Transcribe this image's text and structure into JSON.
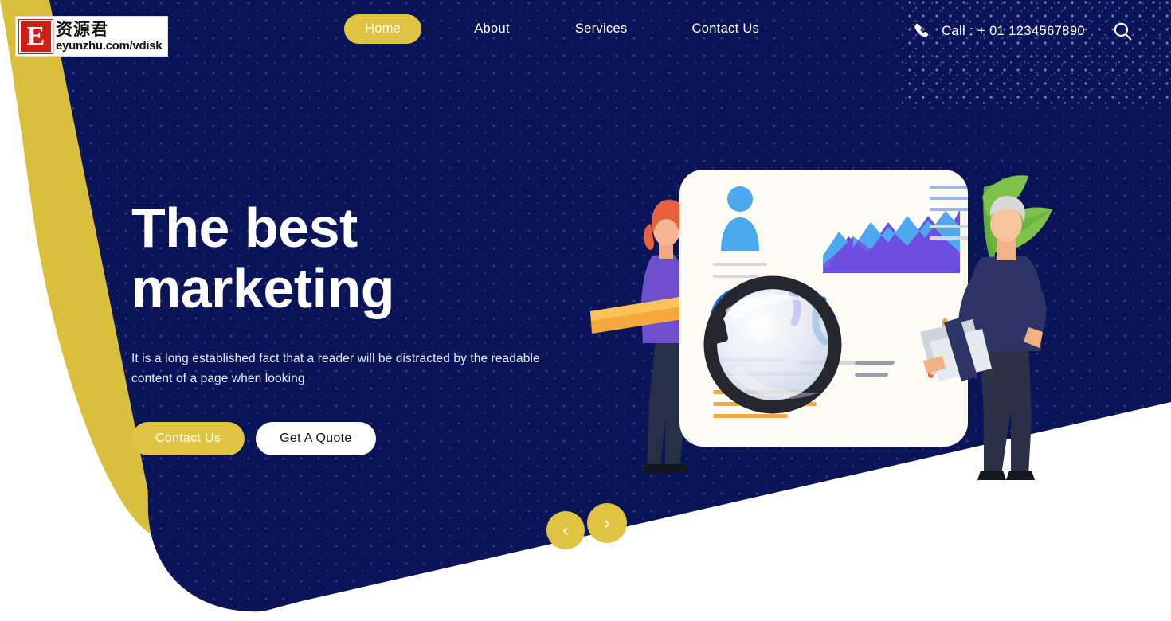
{
  "brand": {
    "logo_letter": "E",
    "logo_cn": "资源君",
    "logo_url": "eyunzhu.com/vdisk"
  },
  "nav": {
    "items": [
      {
        "label": "Home",
        "active": true
      },
      {
        "label": "About",
        "active": false
      },
      {
        "label": "Services",
        "active": false
      },
      {
        "label": "Contact Us",
        "active": false
      }
    ],
    "phone_icon": "phone-icon",
    "call_text": "Call : + 01 1234567890",
    "search_icon": "search-icon"
  },
  "hero": {
    "title_line1": "The best",
    "title_line2": "marketing",
    "paragraph": "It is a long established fact that a reader will be distracted by the readable content of a page when looking",
    "primary_button": "Contact Us",
    "secondary_button": "Get A Quote"
  },
  "carousel": {
    "prev_icon": "‹",
    "next_icon": "›"
  },
  "colors": {
    "navy": "#0a1559",
    "yellow": "#e0c341",
    "cream": "#fdfcf4",
    "white": "#ffffff",
    "leaf_green": "#72bb44",
    "chart_purple": "#6c4fe0",
    "chart_blue": "#4ea8f0",
    "accent_orange": "#f58b33",
    "figure_purple": "#6d4fd0",
    "figure_navy": "#2c3366",
    "hair_orange": "#e8603c"
  },
  "illustration": {
    "name": "marketing-analysis-illustration",
    "elements": [
      "card-panel",
      "user-avatar-icon",
      "area-chart",
      "text-lines",
      "magnifying-glass-icon",
      "woman-figure",
      "man-figure",
      "leaf-decoration",
      "bar-chart"
    ]
  }
}
